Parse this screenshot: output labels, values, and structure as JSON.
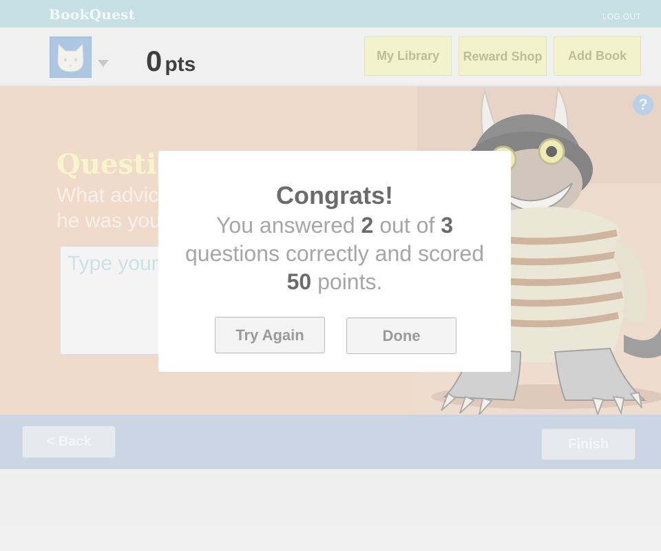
{
  "header": {
    "logo": "BookQuest",
    "logout": "LOG OUT"
  },
  "user": {
    "points": "0",
    "points_unit": "pts"
  },
  "nav": {
    "my_library": "My Library",
    "reward_shop": "Reward Shop",
    "add_book": "Add Book"
  },
  "main": {
    "help": "?",
    "question_title": "Questic",
    "question_line1": "What advic",
    "question_line2": "he was you",
    "answer_placeholder": "Type your"
  },
  "footer": {
    "back": "< Back",
    "finish": "Finish"
  },
  "modal": {
    "title": "Congrats!",
    "msg_1": "You answered ",
    "correct": "2",
    "msg_2": " out of ",
    "total": "3",
    "msg_3": "questions correctly and scored",
    "score": "50",
    "msg_4": " points.",
    "try_again": "Try Again",
    "done": "Done"
  },
  "colors": {
    "modal_bg": "#ffffff",
    "main_bg": "#f0d9c8",
    "bottom_bar": "#c8d4e3",
    "header_bar": "#c4dfe3"
  }
}
